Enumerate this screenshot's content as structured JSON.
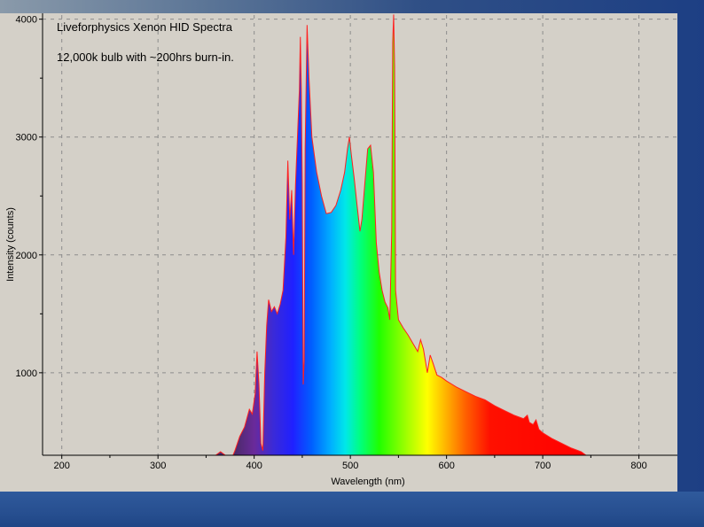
{
  "chart_data": {
    "type": "area",
    "title": "Liveforphysics Xenon HID Spectra",
    "subtitle": "12,000k bulb with ~200hrs burn-in.",
    "xlabel": "Wavelength (nm)",
    "ylabel": "Intensity (counts)",
    "xlim": [
      180,
      840
    ],
    "ylim": [
      300,
      4050
    ],
    "x_ticks": [
      200,
      300,
      400,
      500,
      600,
      700,
      800
    ],
    "y_ticks": [
      1000,
      2000,
      3000,
      4000
    ],
    "grid": true,
    "line_color": "#ff2020",
    "series": [
      {
        "points": [
          [
            180,
            300
          ],
          [
            360,
            300
          ],
          [
            365,
            330
          ],
          [
            370,
            300
          ],
          [
            378,
            300
          ],
          [
            380,
            340
          ],
          [
            385,
            460
          ],
          [
            390,
            540
          ],
          [
            395,
            690
          ],
          [
            398,
            650
          ],
          [
            401,
            820
          ],
          [
            403,
            1180
          ],
          [
            405,
            900
          ],
          [
            407,
            400
          ],
          [
            409,
            340
          ],
          [
            411,
            1000
          ],
          [
            413,
            1400
          ],
          [
            415,
            1620
          ],
          [
            418,
            1520
          ],
          [
            421,
            1560
          ],
          [
            424,
            1500
          ],
          [
            427,
            1580
          ],
          [
            430,
            1700
          ],
          [
            433,
            2150
          ],
          [
            435,
            2800
          ],
          [
            437,
            2300
          ],
          [
            439,
            2550
          ],
          [
            441,
            2000
          ],
          [
            443,
            2600
          ],
          [
            445,
            3000
          ],
          [
            447,
            3400
          ],
          [
            448,
            3850
          ],
          [
            449,
            3400
          ],
          [
            450,
            2600
          ],
          [
            451,
            900
          ],
          [
            452,
            1100
          ],
          [
            453,
            2900
          ],
          [
            455,
            3950
          ],
          [
            457,
            3500
          ],
          [
            460,
            3000
          ],
          [
            465,
            2700
          ],
          [
            470,
            2500
          ],
          [
            475,
            2350
          ],
          [
            480,
            2360
          ],
          [
            485,
            2420
          ],
          [
            490,
            2550
          ],
          [
            494,
            2700
          ],
          [
            497,
            2900
          ],
          [
            499,
            3000
          ],
          [
            501,
            2850
          ],
          [
            504,
            2650
          ],
          [
            507,
            2420
          ],
          [
            510,
            2200
          ],
          [
            512,
            2300
          ],
          [
            515,
            2600
          ],
          [
            518,
            2900
          ],
          [
            521,
            2930
          ],
          [
            524,
            2700
          ],
          [
            527,
            2100
          ],
          [
            530,
            1850
          ],
          [
            533,
            1700
          ],
          [
            536,
            1600
          ],
          [
            539,
            1550
          ],
          [
            541,
            1450
          ],
          [
            543,
            2200
          ],
          [
            544,
            3800
          ],
          [
            545,
            4040
          ],
          [
            546,
            3600
          ],
          [
            547,
            1700
          ],
          [
            550,
            1450
          ],
          [
            555,
            1380
          ],
          [
            560,
            1320
          ],
          [
            565,
            1250
          ],
          [
            570,
            1180
          ],
          [
            573,
            1280
          ],
          [
            576,
            1200
          ],
          [
            578,
            1100
          ],
          [
            580,
            1000
          ],
          [
            583,
            1150
          ],
          [
            586,
            1080
          ],
          [
            590,
            980
          ],
          [
            595,
            960
          ],
          [
            600,
            930
          ],
          [
            610,
            880
          ],
          [
            620,
            840
          ],
          [
            630,
            800
          ],
          [
            640,
            770
          ],
          [
            650,
            720
          ],
          [
            660,
            680
          ],
          [
            670,
            640
          ],
          [
            680,
            610
          ],
          [
            684,
            640
          ],
          [
            686,
            580
          ],
          [
            690,
            560
          ],
          [
            693,
            600
          ],
          [
            696,
            520
          ],
          [
            700,
            490
          ],
          [
            710,
            440
          ],
          [
            720,
            400
          ],
          [
            730,
            360
          ],
          [
            740,
            330
          ],
          [
            745,
            300
          ],
          [
            840,
            300
          ]
        ]
      }
    ]
  }
}
